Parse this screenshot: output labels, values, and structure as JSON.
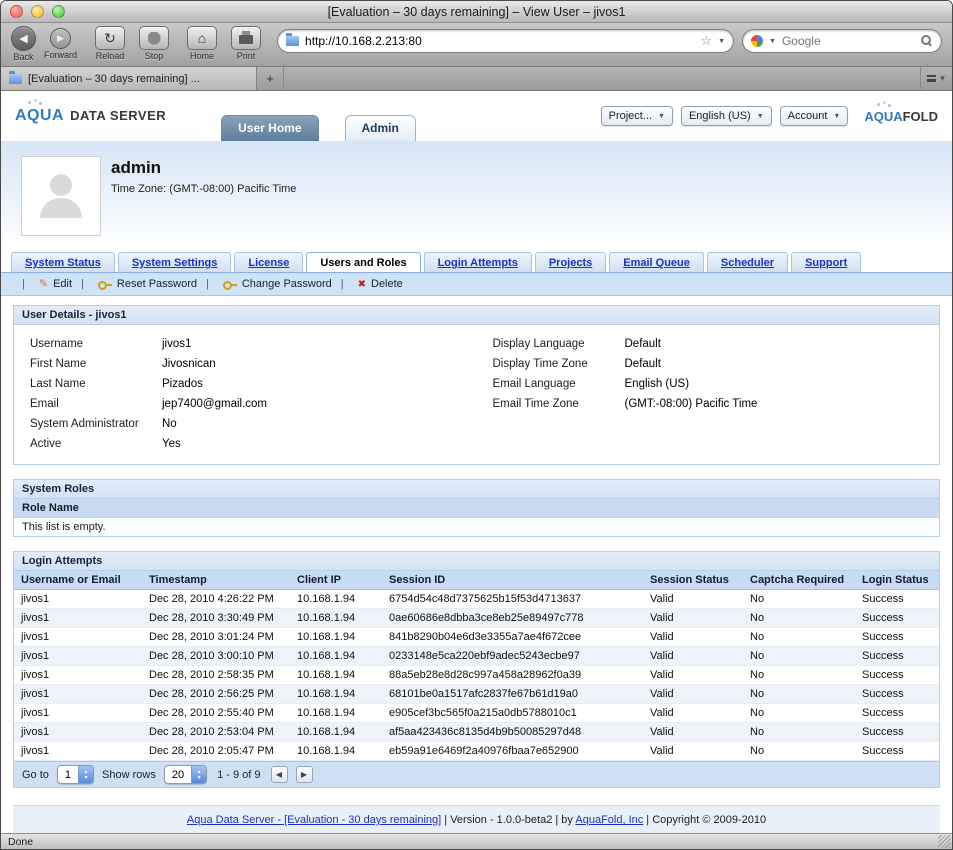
{
  "icons": {
    "back": "◀",
    "forward": "▶",
    "reload": "↻",
    "home": "⌂",
    "star": "☆",
    "dropdown": "▼",
    "new_tab": "+",
    "pager_prev": "◀",
    "pager_next": "▶",
    "stepper_up": "▲",
    "stepper_down": "▼"
  },
  "colors": {
    "link_blue": "#1a31c8",
    "brand_blue": "#2f7bc0",
    "toolbar_blue": "#cfe2f6",
    "table_header_blue": "#c9dbf0"
  },
  "chrome": {
    "window_title": "[Evaluation – 30 days remaining] – View User – jivos1",
    "toolbar": {
      "back": "Back",
      "forward": "Forward",
      "reload": "Reload",
      "stop": "Stop",
      "home": "Home",
      "print": "Print",
      "url": "http://10.168.2.213:80",
      "search_placeholder": "Google"
    },
    "tab_title": "[Evaluation – 30 days remaining] ...",
    "status": "Done"
  },
  "app": {
    "logo_aqua": "AQUA",
    "logo_rest": "DATA SERVER",
    "brand_aqua": "AQUA",
    "brand_rest": "FOLD",
    "nav": [
      {
        "label": "User Home",
        "active": false
      },
      {
        "label": "Admin",
        "active": true
      }
    ],
    "header_controls": [
      {
        "label": "Project..."
      },
      {
        "label": "English (US)"
      },
      {
        "label": "Account"
      }
    ],
    "user_name": "admin",
    "user_timezone": "Time Zone: (GMT:-08:00) Pacific Time"
  },
  "tabs": [
    {
      "label": "System Status",
      "active": false
    },
    {
      "label": "System Settings",
      "active": false
    },
    {
      "label": "License",
      "active": false
    },
    {
      "label": "Users and Roles",
      "active": true
    },
    {
      "label": "Login Attempts",
      "active": false
    },
    {
      "label": "Projects",
      "active": false
    },
    {
      "label": "Email Queue",
      "active": false
    },
    {
      "label": "Scheduler",
      "active": false
    },
    {
      "label": "Support",
      "active": false
    }
  ],
  "actions": [
    {
      "label": "Edit",
      "icon": "edit-icon"
    },
    {
      "label": "Reset Password",
      "icon": "key-icon"
    },
    {
      "label": "Change Password",
      "icon": "key-icon"
    },
    {
      "label": "Delete",
      "icon": "delete-icon"
    }
  ],
  "user_details": {
    "title": "User Details - jivos1",
    "left_fields": [
      {
        "label": "Username",
        "value": "jivos1"
      },
      {
        "label": "First Name",
        "value": "Jivosnican"
      },
      {
        "label": "Last Name",
        "value": "Pizados"
      },
      {
        "label": "Email",
        "value": "jep7400@gmail.com"
      },
      {
        "label": "System Administrator",
        "value": "No"
      },
      {
        "label": "Active",
        "value": "Yes"
      }
    ],
    "right_fields": [
      {
        "label": "Display Language",
        "value": "Default"
      },
      {
        "label": "Display Time Zone",
        "value": "Default"
      },
      {
        "label": "Email Language",
        "value": "English (US)"
      },
      {
        "label": "Email Time Zone",
        "value": "(GMT:-08:00) Pacific Time"
      }
    ]
  },
  "system_roles": {
    "title": "System Roles",
    "column_header": "Role Name",
    "empty_text": "This list is empty."
  },
  "login_attempts": {
    "title": "Login Attempts",
    "columns": [
      "Username or Email",
      "Timestamp",
      "Client IP",
      "Session ID",
      "Session Status",
      "Captcha Required",
      "Login Status"
    ],
    "rows": [
      [
        "jivos1",
        "Dec 28, 2010 4:26:22 PM",
        "10.168.1.94",
        "6754d54c48d7375625b15f53d4713637",
        "Valid",
        "No",
        "Success"
      ],
      [
        "jivos1",
        "Dec 28, 2010 3:30:49 PM",
        "10.168.1.94",
        "0ae60686e8dbba3ce8eb25e89497c778",
        "Valid",
        "No",
        "Success"
      ],
      [
        "jivos1",
        "Dec 28, 2010 3:01:24 PM",
        "10.168.1.94",
        "841b8290b04e6d3e3355a7ae4f672cee",
        "Valid",
        "No",
        "Success"
      ],
      [
        "jivos1",
        "Dec 28, 2010 3:00:10 PM",
        "10.168.1.94",
        "0233148e5ca220ebf9adec5243ecbe97",
        "Valid",
        "No",
        "Success"
      ],
      [
        "jivos1",
        "Dec 28, 2010 2:58:35 PM",
        "10.168.1.94",
        "88a5eb28e8d28c997a458a28962f0a39",
        "Valid",
        "No",
        "Success"
      ],
      [
        "jivos1",
        "Dec 28, 2010 2:56:25 PM",
        "10.168.1.94",
        "68101be0a1517afc2837fe67b61d19a0",
        "Valid",
        "No",
        "Success"
      ],
      [
        "jivos1",
        "Dec 28, 2010 2:55:40 PM",
        "10.168.1.94",
        "e905cef3bc565f0a215a0db5788010c1",
        "Valid",
        "No",
        "Success"
      ],
      [
        "jivos1",
        "Dec 28, 2010 2:53:04 PM",
        "10.168.1.94",
        "af5aa423436c8135d4b9b50085297d48",
        "Valid",
        "No",
        "Success"
      ],
      [
        "jivos1",
        "Dec 28, 2010 2:05:47 PM",
        "10.168.1.94",
        "eb59a91e6469f2a40976fbaa7e652900",
        "Valid",
        "No",
        "Success"
      ]
    ],
    "pagination": {
      "go_to_label": "Go to",
      "page_value": "1",
      "show_rows_label": "Show rows",
      "rows_value": "20",
      "range_text": "1 - 9 of 9"
    }
  },
  "footer": {
    "link1": "Aqua Data Server - [Evaluation - 30 days remaining]",
    "sep1": " | Version - 1.0.0-beta2 | by ",
    "link2": "AquaFold, Inc",
    "sep2": " | Copyright © 2009-2010"
  }
}
